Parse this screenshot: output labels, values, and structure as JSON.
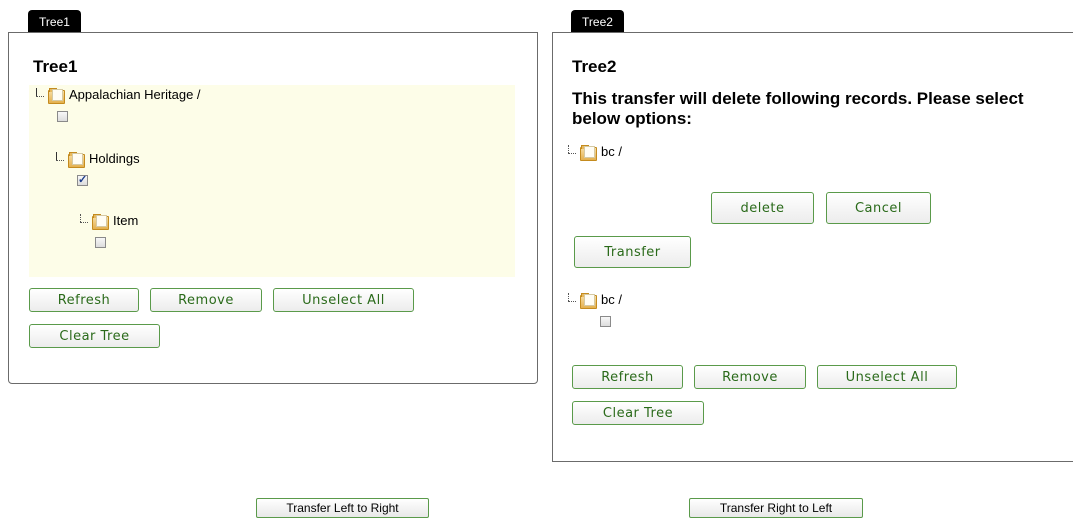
{
  "tree1": {
    "tab": "Tree1",
    "title": "Tree1",
    "nodes": [
      {
        "label": "Appalachian Heritage /",
        "checked": false
      },
      {
        "label": "Holdings",
        "checked": true
      },
      {
        "label": "Item",
        "checked": false
      }
    ],
    "buttons": {
      "refresh": "Refresh",
      "remove": "Remove",
      "unselect_all": "Unselect All",
      "clear_tree": "Clear Tree"
    }
  },
  "tree2": {
    "tab": "Tree2",
    "title": "Tree2",
    "message": "This transfer will delete following records. Please select below options:",
    "delete_node": {
      "label": "bc /"
    },
    "delete_button": "delete",
    "cancel_button": "Cancel",
    "transfer_button": "Transfer",
    "nodes": [
      {
        "label": "bc /",
        "checked": false
      }
    ],
    "buttons": {
      "refresh": "Refresh",
      "remove": "Remove",
      "unselect_all": "Unselect All",
      "clear_tree": "Clear Tree"
    }
  },
  "transfer": {
    "left_to_right": "Transfer Left to Right",
    "right_to_left": "Transfer Right to Left"
  },
  "colors": {
    "button_border": "#5a9a4a",
    "button_text": "#2a6a1a",
    "tree_bg": "#fdfde8",
    "tab_bg": "#000000"
  }
}
